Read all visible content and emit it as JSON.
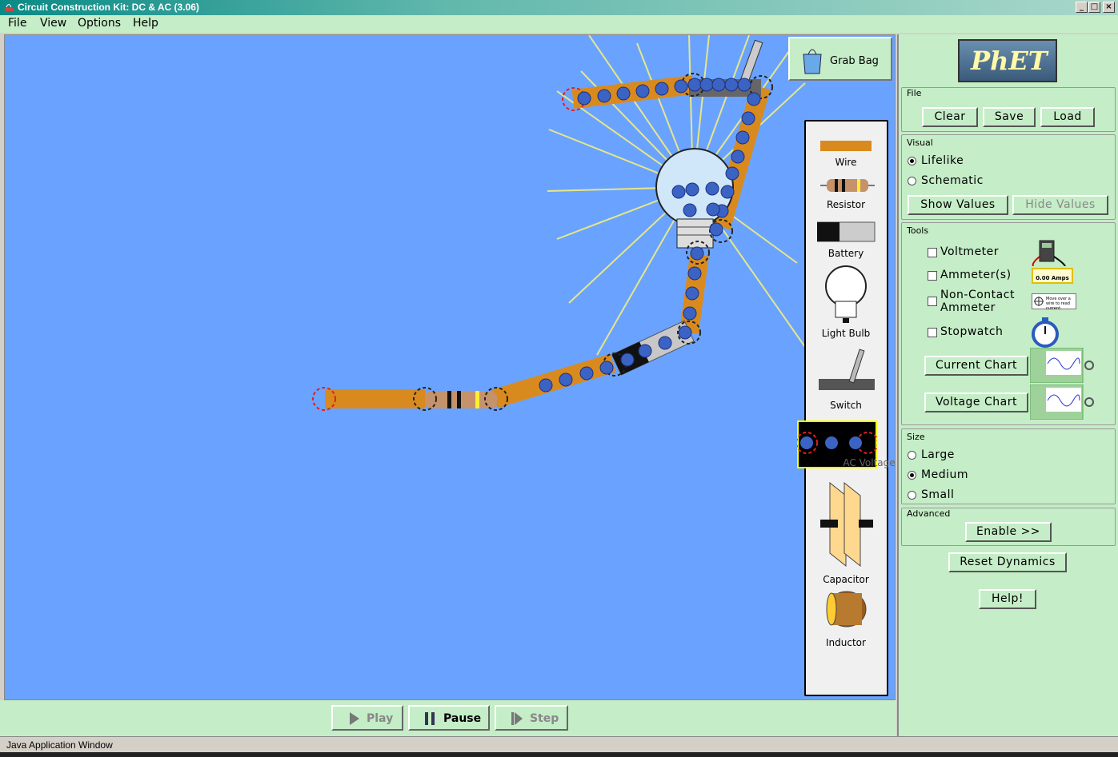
{
  "window": {
    "title": "Circuit Construction Kit: DC & AC (3.06)"
  },
  "menu": [
    "File",
    "View",
    "Options",
    "Help"
  ],
  "grab_bag": "Grab Bag",
  "toolbox": [
    "Wire",
    "Resistor",
    "Battery",
    "Light Bulb",
    "Switch",
    "AC Voltage",
    "Capacitor",
    "Inductor"
  ],
  "playback": {
    "play": "Play",
    "pause": "Pause",
    "step": "Step"
  },
  "logo": "PhET",
  "panel": {
    "file": {
      "title": "File",
      "clear": "Clear",
      "save": "Save",
      "load": "Load"
    },
    "visual": {
      "title": "Visual",
      "lifelike": "Lifelike",
      "schematic": "Schematic",
      "selected": "Lifelike",
      "show_values": "Show Values",
      "hide_values": "Hide Values"
    },
    "tools": {
      "title": "Tools",
      "voltmeter": "Voltmeter",
      "ammeter": "Ammeter(s)",
      "noncontact_1": "Non-Contact",
      "noncontact_2": "Ammeter",
      "stopwatch": "Stopwatch",
      "current_chart": "Current Chart",
      "voltage_chart": "Voltage Chart",
      "amps_readout": "0.00 Amps",
      "noncontact_hint": "Move over a wire to read current."
    },
    "size": {
      "title": "Size",
      "large": "Large",
      "medium": "Medium",
      "small": "Small",
      "selected": "Medium"
    },
    "advanced": {
      "title": "Advanced",
      "enable": "Enable >>"
    },
    "reset": "Reset Dynamics",
    "help": "Help!"
  },
  "status": "Java Application Window",
  "colors": {
    "canvas": "#6aa3ff",
    "panel": "#c5edc7",
    "wire": "#d98a1e",
    "electron": "#3b63c4"
  }
}
